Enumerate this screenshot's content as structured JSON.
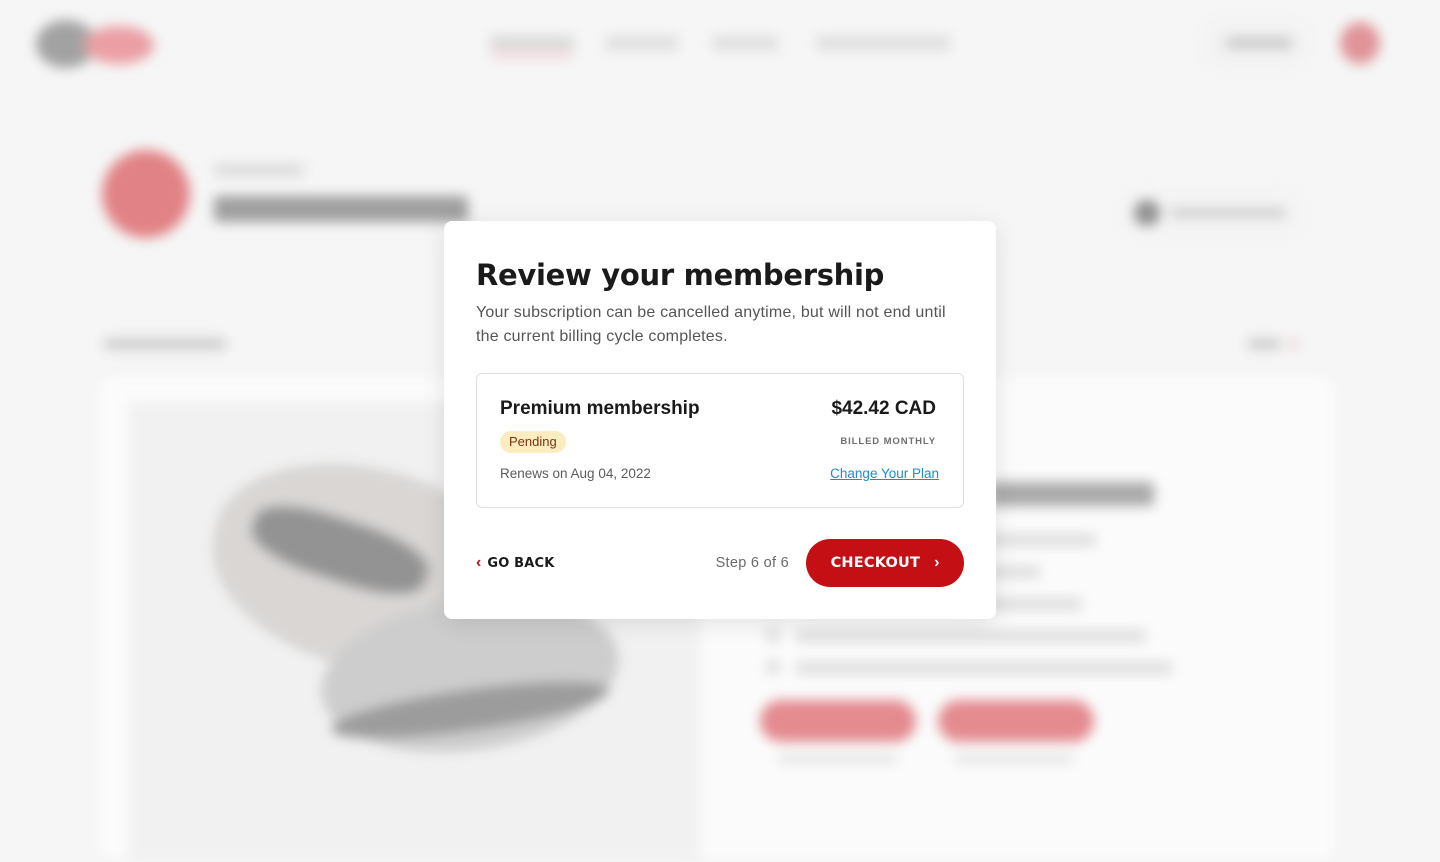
{
  "modal": {
    "title": "Review your membership",
    "description": "Your subscription can be cancelled anytime, but will not end until the current billing cycle completes.",
    "plan": {
      "name": "Premium membership",
      "price": "$42.42 CAD",
      "status": "Pending",
      "billing_period": "BILLED MONTHLY",
      "renewal": "Renews on Aug 04, 2022",
      "change_plan_label": "Change Your Plan"
    },
    "footer": {
      "back_icon": "chevron-left-icon",
      "back_label": "GO BACK",
      "step_text": "Step 6 of 6",
      "checkout_label": "CHECKOUT",
      "checkout_icon": "chevron-right-icon"
    }
  },
  "colors": {
    "brand_red": "#c40f14",
    "link_blue": "#1f8ccc",
    "badge_bg": "#fcedc0",
    "badge_text": "#7a3410"
  }
}
